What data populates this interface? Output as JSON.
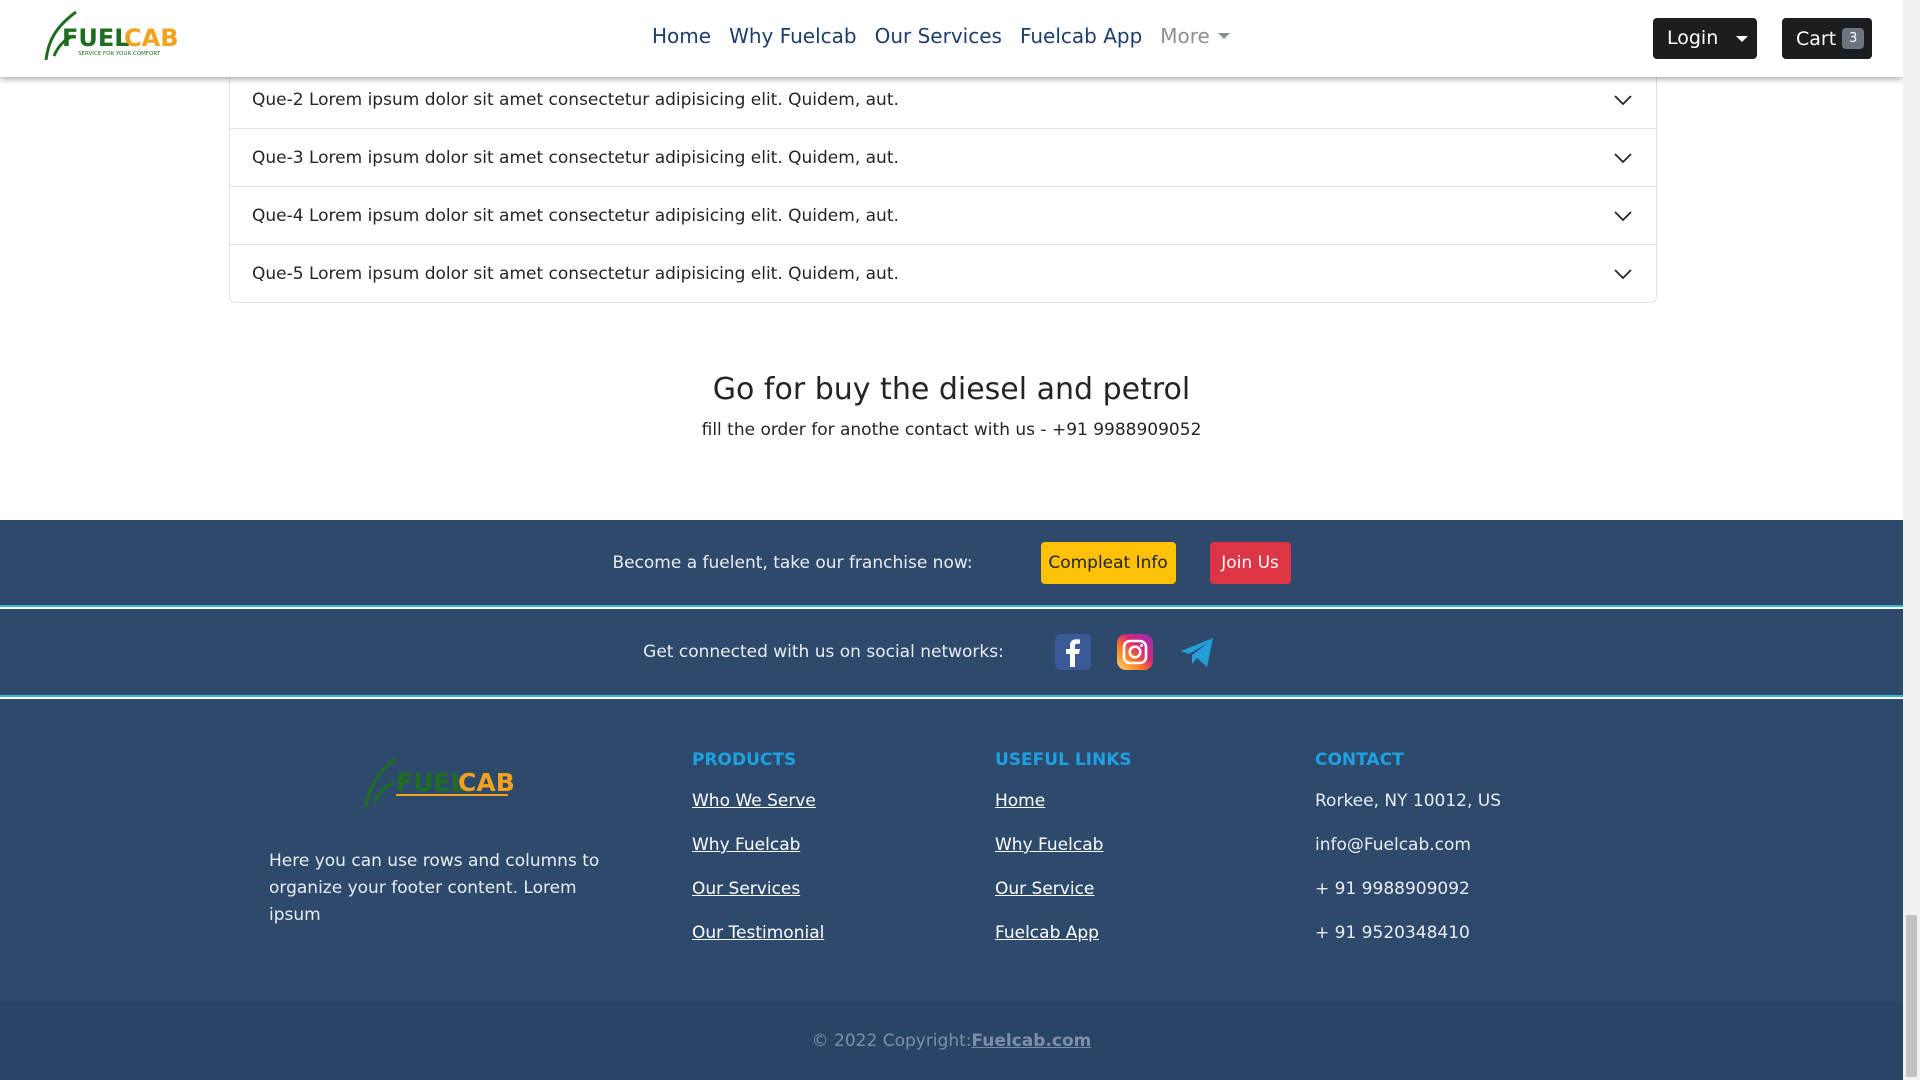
{
  "brand": {
    "name_part1": "FUEL",
    "name_part2": "CAB",
    "tagline": "SERVICE FOR YOUR COMFORT"
  },
  "nav": {
    "links": [
      "Home",
      "Why Fuelcab",
      "Our Services",
      "Fuelcab App"
    ],
    "more_label": "More",
    "login_label": "Login",
    "cart_label": "Cart",
    "cart_count": "3"
  },
  "faq": [
    "Que-2 Lorem ipsum dolor sit amet consectetur adipisicing elit. Quidem, aut.",
    "Que-3 Lorem ipsum dolor sit amet consectetur adipisicing elit. Quidem, aut.",
    "Que-4 Lorem ipsum dolor sit amet consectetur adipisicing elit. Quidem, aut.",
    "Que-5 Lorem ipsum dolor sit amet consectetur adipisicing elit. Quidem, aut."
  ],
  "cta": {
    "title": "Go for buy the diesel and petrol",
    "subtitle": "fill the order for anothe contact with us - +91 9988909052"
  },
  "franchise": {
    "text": "Become a fuelent, take our franchise now:",
    "info_button": "Compleat Info",
    "join_button": "Join Us"
  },
  "social": {
    "text": "Get connected with us on social networks:"
  },
  "footer": {
    "about": "Here you can use rows and columns to organize your footer content. Lorem ipsum",
    "products_heading": "PRODUCTS",
    "products": [
      "Who We Serve",
      "Why Fuelcab",
      "Our Services",
      "Our Testimonial"
    ],
    "links_heading": "USEFUL LINKS",
    "links": [
      "Home",
      "Why Fuelcab",
      "Our Service",
      "Fuelcab App"
    ],
    "contact_heading": "CONTACT",
    "contact": [
      "Rorkee, NY 10012, US",
      "info@Fuelcab.com",
      "+ 91 9988909092",
      "+ 91 9520348410"
    ],
    "copyright": "© 2022 Copyright:",
    "copyright_link": "Fuelcab.com"
  },
  "colors": {
    "footer_bg": "#2d4a6d",
    "footer_bottom_bg": "#284567",
    "divider": "#35b8d6",
    "heading_blue": "#1da1e2",
    "logo_green": "#1f6e1f",
    "logo_orange": "#f4a11d"
  },
  "icons": [
    "chevron-down-icon",
    "caret-down-icon",
    "facebook-icon",
    "instagram-icon",
    "telegram-icon"
  ]
}
